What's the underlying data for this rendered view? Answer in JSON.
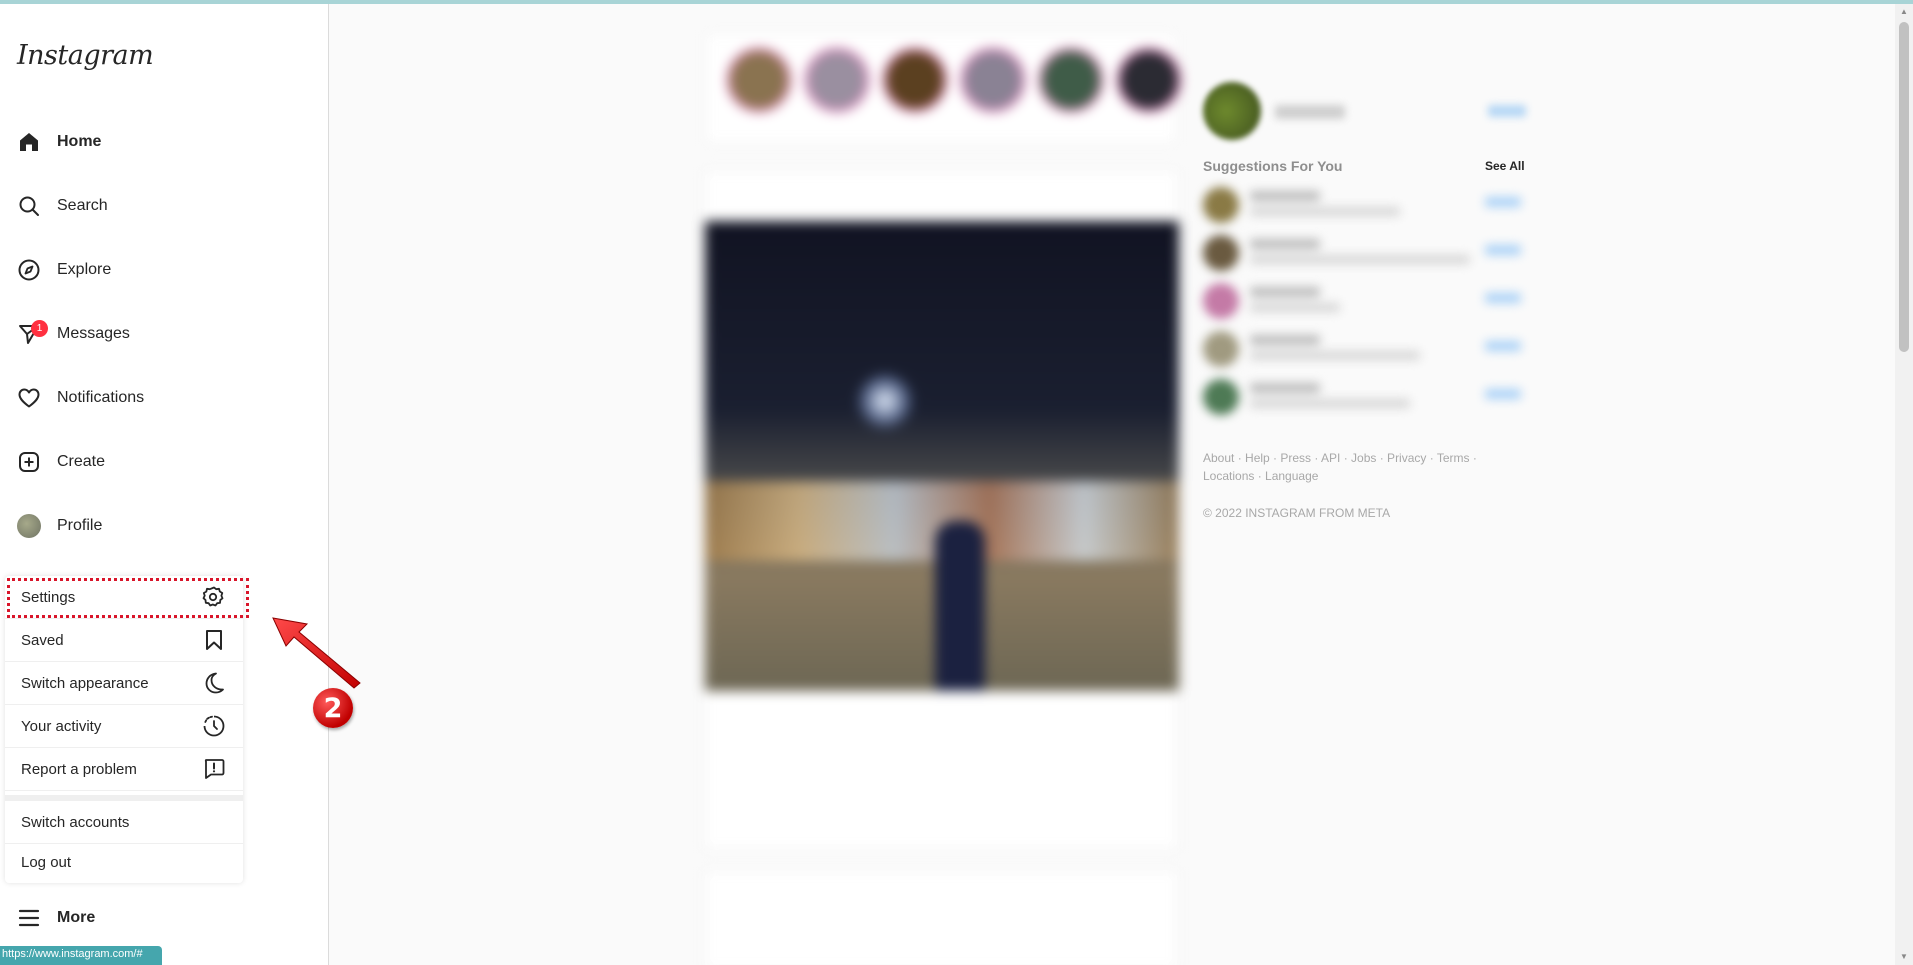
{
  "app": {
    "logo": "Instagram"
  },
  "nav": {
    "items": [
      {
        "key": "home",
        "label": "Home",
        "icon": "home-icon",
        "bold": true
      },
      {
        "key": "search",
        "label": "Search",
        "icon": "search-icon"
      },
      {
        "key": "explore",
        "label": "Explore",
        "icon": "compass-icon"
      },
      {
        "key": "messages",
        "label": "Messages",
        "icon": "messenger-icon",
        "badge": "1"
      },
      {
        "key": "notifications",
        "label": "Notifications",
        "icon": "heart-icon"
      },
      {
        "key": "create",
        "label": "Create",
        "icon": "plus-square-icon"
      },
      {
        "key": "profile",
        "label": "Profile",
        "icon": "avatar"
      }
    ],
    "more_label": "More"
  },
  "menu": {
    "items": [
      {
        "key": "settings",
        "label": "Settings",
        "icon": "gear-icon"
      },
      {
        "key": "saved",
        "label": "Saved",
        "icon": "bookmark-icon"
      },
      {
        "key": "switch_appearance",
        "label": "Switch appearance",
        "icon": "moon-icon"
      },
      {
        "key": "your_activity",
        "label": "Your activity",
        "icon": "activity-clock-icon"
      },
      {
        "key": "report_problem",
        "label": "Report a problem",
        "icon": "report-icon"
      },
      {
        "key": "switch_accounts",
        "label": "Switch accounts"
      },
      {
        "key": "log_out",
        "label": "Log out"
      }
    ]
  },
  "annotation": {
    "step": "2",
    "color": "#d9152a"
  },
  "status_bar": {
    "url": "https://www.instagram.com/#"
  },
  "right": {
    "suggestions_title": "Suggestions For You",
    "see_all": "See All",
    "footer_links": "About · Help · Press · API · Jobs · Privacy · Terms · Locations · Language",
    "copyright": "© 2022 INSTAGRAM FROM META"
  },
  "colors": {
    "accent_blue": "#0095f6",
    "badge": "#ff3040",
    "highlight": "#d9152a"
  }
}
